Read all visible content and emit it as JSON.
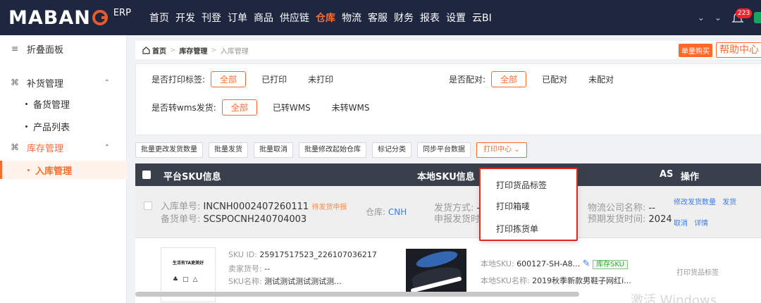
{
  "brand": {
    "name": "MABAN",
    "suffix": "ERP"
  },
  "nav": [
    "首页",
    "开发",
    "刊登",
    "订单",
    "商品",
    "供应链",
    "仓库",
    "物流",
    "客服",
    "财务",
    "报表",
    "设置",
    "云BI"
  ],
  "nav_active_index": 6,
  "topbar": {
    "notification_count": "223"
  },
  "sidebar": {
    "collapse": "折叠面板",
    "groups": [
      {
        "label": "补货管理",
        "items": [
          "备货管理",
          "产品列表"
        ]
      },
      {
        "label": "库存管理",
        "items": [
          "入库管理"
        ]
      }
    ]
  },
  "breadcrumb": {
    "home": "首页",
    "level1": "库存管理",
    "current": "入库管理"
  },
  "header_buttons": {
    "buy": "单量购买",
    "help": "帮助中心"
  },
  "filters": {
    "print_label": {
      "label": "是否打印标签:",
      "selected": "全部",
      "options": [
        "已打印",
        "未打印"
      ]
    },
    "paired": {
      "label": "是否配对:",
      "selected": "全部",
      "options": [
        "已配对",
        "未配对"
      ]
    },
    "wms": {
      "label": "是否转wms发货:",
      "selected": "全部",
      "options": [
        "已转WMS",
        "未转WMS"
      ]
    }
  },
  "actions": [
    "批量更改发货数量",
    "批量发货",
    "批量取消",
    "批量修改起始仓库",
    "标记分类",
    "同步平台数据",
    "打印中心"
  ],
  "table": {
    "headers": [
      "平台SKU信息",
      "本地SKU信息",
      "AS",
      "操作"
    ]
  },
  "group_row": {
    "inbound_label": "入库单号:",
    "inbound_no": "INCNH0002407260111",
    "status": "待发货申报",
    "stock_label": "备货单号:",
    "stock_no": "SCSPOCNH240704003",
    "warehouse_label": "仓库:",
    "warehouse": "CNH",
    "ship_method_label": "发货方式:",
    "ship_method": "--",
    "declare_time_label": "申报发货时间",
    "carrier_label": "物流公司名称:",
    "carrier": "--",
    "expected_label": "预期发货时间:",
    "expected": "2024",
    "ops": [
      "修改发货数量",
      "发货",
      "取消",
      "详情"
    ]
  },
  "item": {
    "thumb_title": "生活有TA更美好",
    "sku_id_label": "SKU ID:",
    "sku_id": "25917517523_226107036217",
    "seller_no_label": "卖家货号:",
    "seller_no": "--",
    "sku_name_label": "SKU名称:",
    "sku_name": "测试测试测试测试测...",
    "local_sku_label": "本地SKU:",
    "local_sku": "600127-SH-A8...",
    "stock_tag": "库存SKU",
    "local_name_label": "本地SKU名称:",
    "local_name": "2019秋季新款男鞋子网红i...",
    "op": "打印货品标签"
  },
  "print_menu": [
    "打印货品标签",
    "打印箱唛",
    "打印拣货单"
  ],
  "watermark": "激活 Windows",
  "colors": {
    "accent": "#ff6a2a",
    "topbar": "#1f2740",
    "table_header": "#3a3f4c",
    "highlight_border": "#e0261b"
  }
}
